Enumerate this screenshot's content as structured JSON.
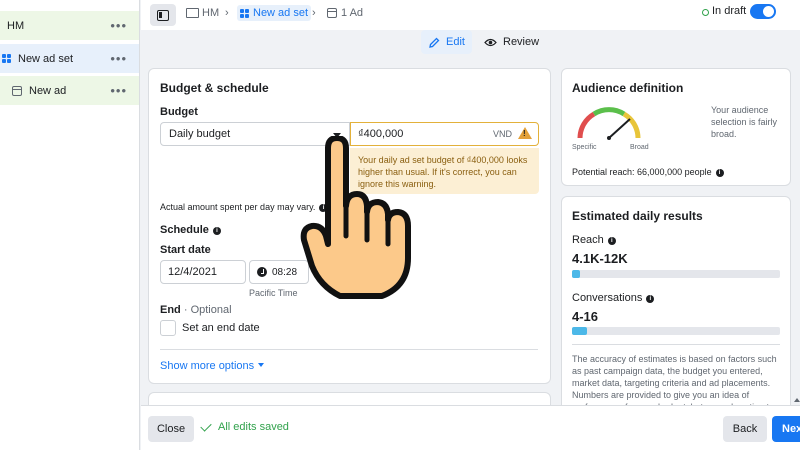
{
  "sidebar": {
    "campaign": {
      "label": "HM"
    },
    "adset": {
      "label": "New ad set"
    },
    "ad": {
      "label": "New ad"
    },
    "more_label": "•••"
  },
  "breadcrumb": {
    "campaign": "HM",
    "adset": "New ad set",
    "ad": "1 Ad",
    "separator": "›"
  },
  "status": {
    "draft_label": "In draft",
    "toggle_on": true
  },
  "tabs": {
    "edit": "Edit",
    "review": "Review"
  },
  "budget_card": {
    "title": "Budget & schedule",
    "budget_label": "Budget",
    "budget_type": "Daily budget",
    "amount": "₫400,000",
    "currency": "VND",
    "warning": "Your daily ad set budget of ₫400,000 looks higher than usual. If it's correct, you can ignore this warning.",
    "note": "Actual amount spent per day may vary.",
    "schedule_label": "Schedule",
    "start_date_label": "Start date",
    "start_date": "12/4/2021",
    "start_time": "08:28",
    "timezone": "Pacific Time",
    "end_label": "End",
    "end_optional": "· Optional",
    "end_checkbox_label": "Set an end date",
    "more_options": "Show more options"
  },
  "audience": {
    "title": "Audience definition",
    "gauge_left": "Specific",
    "gauge_right": "Broad",
    "description": "Your audience selection is fairly broad.",
    "potential_reach": "Potential reach: 66,000,000 people"
  },
  "estimates": {
    "title": "Estimated daily results",
    "reach_label": "Reach",
    "reach_value": "4.1K-12K",
    "reach_fill": 0.04,
    "conversations_label": "Conversations",
    "conversations_value": "4-16",
    "conversations_fill": 0.07,
    "note": "The accuracy of estimates is based on factors such as past campaign data, the budget you entered, market data, targeting criteria and ad placements. Numbers are provided to give you an idea of performance for your budget, but are only estimates and don't guarantee"
  },
  "footer": {
    "close": "Close",
    "saved": "All edits saved",
    "back": "Back",
    "next": "Next"
  },
  "colors": {
    "accent": "#1877f2",
    "success": "#31a24c",
    "warning_bg": "#fcefd4",
    "bar": "#4cb8e8"
  }
}
